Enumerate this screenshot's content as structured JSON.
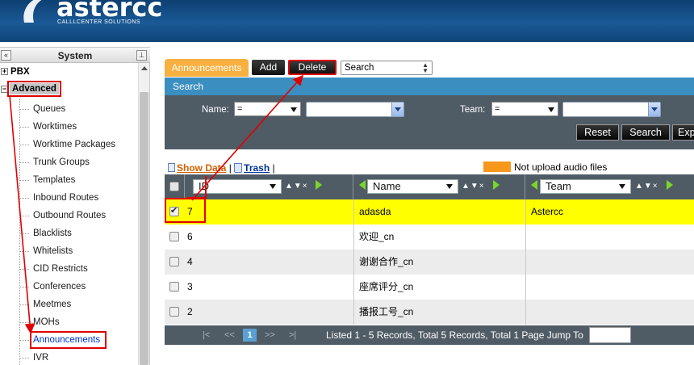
{
  "header": {
    "logo_text": "astercc",
    "logo_sub": "CALLLCENTER SOLUTIONS"
  },
  "sidebar": {
    "collapse_label": "«",
    "title": "System",
    "pin_label": "⊥",
    "plus_label": "+",
    "minus_label": "−",
    "roots": [
      {
        "label": "PBX"
      },
      {
        "label": "Advanced"
      }
    ],
    "items": [
      {
        "label": "Queues"
      },
      {
        "label": "Worktimes"
      },
      {
        "label": "Worktime Packages"
      },
      {
        "label": "Trunk Groups"
      },
      {
        "label": "Templates"
      },
      {
        "label": "Inbound Routes"
      },
      {
        "label": "Outbound Routes"
      },
      {
        "label": "Blacklists"
      },
      {
        "label": "Whitelists"
      },
      {
        "label": "CID Restricts"
      },
      {
        "label": "Conferences"
      },
      {
        "label": "Meetmes"
      },
      {
        "label": "MOHs"
      },
      {
        "label": "Announcements"
      },
      {
        "label": "IVR"
      }
    ]
  },
  "toolbar": {
    "tab_label": "Announcements",
    "add_label": "Add",
    "delete_label": "Delete",
    "search_select": "Search"
  },
  "search": {
    "bar_label": "Search",
    "name_label": "Name:",
    "name_op": "=",
    "team_label": "Team:",
    "team_op": "=",
    "reset_label": "Reset",
    "search_label": "Search",
    "export_label": "Exp"
  },
  "links": {
    "separator": "|",
    "show_data": "Show Data",
    "trash": "Trash",
    "legend": "Not upload audio files"
  },
  "colors": {
    "legend_swatch": "#f7981d",
    "selected_row": "#ffff00"
  },
  "grid": {
    "columns": [
      {
        "label": "ID"
      },
      {
        "label": "Name"
      },
      {
        "label": "Team"
      }
    ],
    "sort_label": "▲▼×",
    "rows": [
      {
        "id": "7",
        "name": "adasda",
        "team": "Astercc",
        "checked": true
      },
      {
        "id": "6",
        "name": "欢迎_cn",
        "team": "",
        "checked": false
      },
      {
        "id": "4",
        "name": "谢谢合作_cn",
        "team": "",
        "checked": false
      },
      {
        "id": "3",
        "name": "座席评分_cn",
        "team": "",
        "checked": false
      },
      {
        "id": "2",
        "name": "播报工号_cn",
        "team": "",
        "checked": false
      }
    ]
  },
  "pager": {
    "first": "|<",
    "prev": "<<",
    "current_page": "1",
    "next": ">>",
    "last": ">|",
    "info": "Listed 1 - 5 Records, Total 5 Records, Total 1 Page Jump To"
  }
}
